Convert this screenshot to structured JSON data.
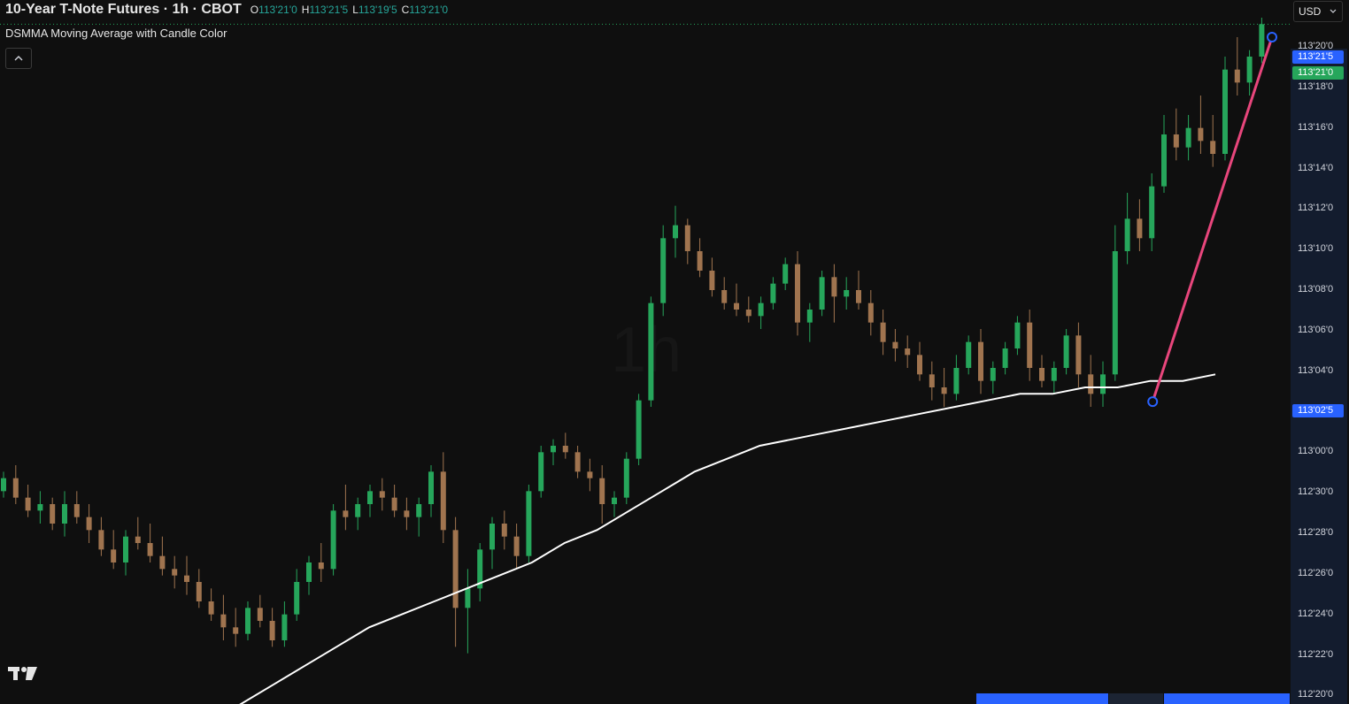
{
  "header": {
    "symbol_title": "10-Year T-Note Futures · 1h · CBOT",
    "ohlc": [
      {
        "key": "O",
        "value": "113'21'0"
      },
      {
        "key": "H",
        "value": "113'21'5"
      },
      {
        "key": "L",
        "value": "113'19'5"
      },
      {
        "key": "C",
        "value": "113'21'0"
      }
    ],
    "indicator_name": "DSMMA Moving Average with Candle Color",
    "currency": "USD"
  },
  "colors": {
    "background": "#0f0f0f",
    "up": "#26a65b",
    "down": "#a0744f",
    "ma_line": "#ffffff",
    "trend_line": "#e8467c",
    "axis_bg": "#131c2e",
    "badge_blue": "#2962ff",
    "badge_green": "#26a65b"
  },
  "icons": {
    "collapse": "chevron-up-icon",
    "currency_dropdown": "chevron-down-icon",
    "logo": "tradingview-logo-icon"
  },
  "watermark": "1h",
  "price_badges": {
    "high": "113'21'5",
    "last": "113'21'0",
    "anchor": "113'02'5"
  },
  "chart_data": {
    "type": "candlestick",
    "title": "10-Year T-Note Futures · 1h · CBOT",
    "y_ticks": [
      {
        "label": "113'20'0",
        "value": 113.625
      },
      {
        "label": "113'18'0",
        "value": 113.5625
      },
      {
        "label": "113'16'0",
        "value": 113.5
      },
      {
        "label": "113'14'0",
        "value": 113.4375
      },
      {
        "label": "113'12'0",
        "value": 113.375
      },
      {
        "label": "113'10'0",
        "value": 113.3125
      },
      {
        "label": "113'08'0",
        "value": 113.25
      },
      {
        "label": "113'06'0",
        "value": 113.1875
      },
      {
        "label": "113'04'0",
        "value": 113.125
      },
      {
        "label": "113'02'0",
        "value": 113.0625
      },
      {
        "label": "113'00'0",
        "value": 113.0
      },
      {
        "label": "112'30'0",
        "value": 112.9375
      },
      {
        "label": "112'28'0",
        "value": 112.875
      },
      {
        "label": "112'26'0",
        "value": 112.8125
      },
      {
        "label": "112'24'0",
        "value": 112.75
      },
      {
        "label": "112'22'0",
        "value": 112.6875
      },
      {
        "label": "112'20'0",
        "value": 112.625
      }
    ],
    "ylim": [
      112.62,
      113.67
    ],
    "legend": "top-left",
    "grid": false,
    "candles_ohlc": [
      [
        112.94,
        112.97,
        112.93,
        112.96
      ],
      [
        112.96,
        112.98,
        112.92,
        112.93
      ],
      [
        112.93,
        112.95,
        112.9,
        112.91
      ],
      [
        112.91,
        112.94,
        112.89,
        112.92
      ],
      [
        112.92,
        112.93,
        112.88,
        112.89
      ],
      [
        112.89,
        112.94,
        112.87,
        112.92
      ],
      [
        112.92,
        112.94,
        112.89,
        112.9
      ],
      [
        112.9,
        112.92,
        112.86,
        112.88
      ],
      [
        112.88,
        112.9,
        112.84,
        112.85
      ],
      [
        112.85,
        112.88,
        112.82,
        112.83
      ],
      [
        112.83,
        112.88,
        112.81,
        112.87
      ],
      [
        112.87,
        112.9,
        112.85,
        112.86
      ],
      [
        112.86,
        112.89,
        112.83,
        112.84
      ],
      [
        112.84,
        112.87,
        112.81,
        112.82
      ],
      [
        112.82,
        112.84,
        112.79,
        112.81
      ],
      [
        112.81,
        112.84,
        112.78,
        112.8
      ],
      [
        112.8,
        112.82,
        112.76,
        112.77
      ],
      [
        112.77,
        112.79,
        112.74,
        112.75
      ],
      [
        112.75,
        112.78,
        112.71,
        112.73
      ],
      [
        112.73,
        112.76,
        112.7,
        112.72
      ],
      [
        112.72,
        112.77,
        112.71,
        112.76
      ],
      [
        112.76,
        112.78,
        112.73,
        112.74
      ],
      [
        112.74,
        112.76,
        112.7,
        112.71
      ],
      [
        112.71,
        112.77,
        112.7,
        112.75
      ],
      [
        112.75,
        112.82,
        112.74,
        112.8
      ],
      [
        112.8,
        112.84,
        112.78,
        112.83
      ],
      [
        112.83,
        112.86,
        112.8,
        112.82
      ],
      [
        112.82,
        112.92,
        112.81,
        112.91
      ],
      [
        112.91,
        112.95,
        112.88,
        112.9
      ],
      [
        112.9,
        112.93,
        112.88,
        112.92
      ],
      [
        112.92,
        112.95,
        112.9,
        112.94
      ],
      [
        112.94,
        112.96,
        112.91,
        112.93
      ],
      [
        112.93,
        112.95,
        112.9,
        112.91
      ],
      [
        112.91,
        112.93,
        112.88,
        112.9
      ],
      [
        112.9,
        112.93,
        112.87,
        112.92
      ],
      [
        112.92,
        112.98,
        112.9,
        112.97
      ],
      [
        112.97,
        113.0,
        112.86,
        112.88
      ],
      [
        112.88,
        112.9,
        112.7,
        112.76
      ],
      [
        112.76,
        112.82,
        112.69,
        112.79
      ],
      [
        112.79,
        112.86,
        112.77,
        112.85
      ],
      [
        112.85,
        112.9,
        112.82,
        112.89
      ],
      [
        112.89,
        112.91,
        112.85,
        112.87
      ],
      [
        112.87,
        112.89,
        112.82,
        112.84
      ],
      [
        112.84,
        112.95,
        112.83,
        112.94
      ],
      [
        112.94,
        113.01,
        112.93,
        113.0
      ],
      [
        113.0,
        113.02,
        112.98,
        113.01
      ],
      [
        113.01,
        113.03,
        112.99,
        113.0
      ],
      [
        113.0,
        113.01,
        112.96,
        112.97
      ],
      [
        112.97,
        112.99,
        112.94,
        112.96
      ],
      [
        112.96,
        112.98,
        112.89,
        112.92
      ],
      [
        112.92,
        112.94,
        112.9,
        112.93
      ],
      [
        112.93,
        113.0,
        112.92,
        112.99
      ],
      [
        112.99,
        113.09,
        112.98,
        113.08
      ],
      [
        113.08,
        113.24,
        113.07,
        113.23
      ],
      [
        113.23,
        113.35,
        113.21,
        113.33
      ],
      [
        113.33,
        113.38,
        113.3,
        113.35
      ],
      [
        113.35,
        113.36,
        113.29,
        113.31
      ],
      [
        113.31,
        113.33,
        113.27,
        113.28
      ],
      [
        113.28,
        113.3,
        113.24,
        113.25
      ],
      [
        113.25,
        113.27,
        113.22,
        113.23
      ],
      [
        113.23,
        113.26,
        113.21,
        113.22
      ],
      [
        113.22,
        113.24,
        113.2,
        113.21
      ],
      [
        113.21,
        113.24,
        113.19,
        113.23
      ],
      [
        113.23,
        113.27,
        113.22,
        113.26
      ],
      [
        113.26,
        113.3,
        113.25,
        113.29
      ],
      [
        113.29,
        113.31,
        113.18,
        113.2
      ],
      [
        113.2,
        113.23,
        113.17,
        113.22
      ],
      [
        113.22,
        113.28,
        113.21,
        113.27
      ],
      [
        113.27,
        113.29,
        113.2,
        113.24
      ],
      [
        113.24,
        113.27,
        113.22,
        113.25
      ],
      [
        113.25,
        113.28,
        113.22,
        113.23
      ],
      [
        113.23,
        113.25,
        113.18,
        113.2
      ],
      [
        113.2,
        113.22,
        113.15,
        113.17
      ],
      [
        113.17,
        113.19,
        113.14,
        113.16
      ],
      [
        113.16,
        113.18,
        113.13,
        113.15
      ],
      [
        113.15,
        113.17,
        113.11,
        113.12
      ],
      [
        113.12,
        113.14,
        113.08,
        113.1
      ],
      [
        113.1,
        113.13,
        113.07,
        113.09
      ],
      [
        113.09,
        113.15,
        113.08,
        113.13
      ],
      [
        113.13,
        113.18,
        113.12,
        113.17
      ],
      [
        113.17,
        113.19,
        113.09,
        113.11
      ],
      [
        113.11,
        113.14,
        113.09,
        113.13
      ],
      [
        113.13,
        113.17,
        113.12,
        113.16
      ],
      [
        113.16,
        113.21,
        113.15,
        113.2
      ],
      [
        113.2,
        113.22,
        113.11,
        113.13
      ],
      [
        113.13,
        113.15,
        113.1,
        113.11
      ],
      [
        113.11,
        113.14,
        113.09,
        113.13
      ],
      [
        113.13,
        113.19,
        113.12,
        113.18
      ],
      [
        113.18,
        113.2,
        113.1,
        113.12
      ],
      [
        113.12,
        113.15,
        113.07,
        113.09
      ],
      [
        113.09,
        113.14,
        113.07,
        113.12
      ],
      [
        113.12,
        113.35,
        113.11,
        113.31
      ],
      [
        113.31,
        113.4,
        113.29,
        113.36
      ],
      [
        113.36,
        113.39,
        113.31,
        113.33
      ],
      [
        113.33,
        113.43,
        113.31,
        113.41
      ],
      [
        113.41,
        113.52,
        113.4,
        113.49
      ],
      [
        113.49,
        113.53,
        113.45,
        113.47
      ],
      [
        113.47,
        113.52,
        113.45,
        113.5
      ],
      [
        113.5,
        113.55,
        113.46,
        113.48
      ],
      [
        113.48,
        113.52,
        113.44,
        113.46
      ],
      [
        113.46,
        113.61,
        113.45,
        113.59
      ],
      [
        113.59,
        113.64,
        113.55,
        113.57
      ],
      [
        113.57,
        113.62,
        113.55,
        113.61
      ],
      [
        113.61,
        113.67,
        113.6,
        113.66
      ]
    ],
    "ma_series": [
      112.61,
      112.64,
      112.67,
      112.7,
      112.73,
      112.75,
      112.77,
      112.79,
      112.81,
      112.83,
      112.86,
      112.88,
      112.91,
      112.94,
      112.97,
      112.99,
      113.01,
      113.02,
      113.03,
      113.04,
      113.05,
      113.06,
      113.07,
      113.08,
      113.09,
      113.09,
      113.1,
      113.1,
      113.11,
      113.11,
      113.12
    ],
    "trend_line": {
      "from": {
        "candle": 94,
        "value": 113.078
      },
      "to": {
        "candle": 104,
        "value": 113.64
      }
    }
  }
}
